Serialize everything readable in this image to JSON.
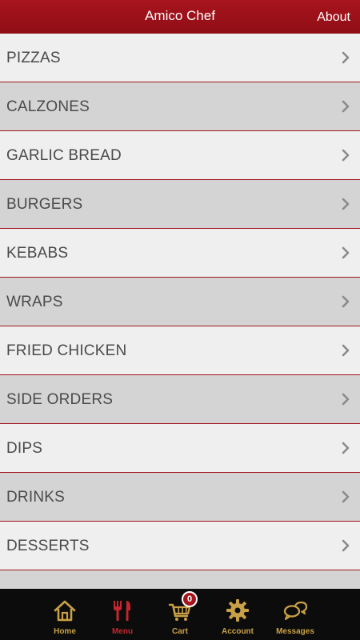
{
  "header": {
    "title": "Amico Chef",
    "about_label": "About"
  },
  "menu": {
    "categories": [
      {
        "label": "PIZZAS"
      },
      {
        "label": "CALZONES"
      },
      {
        "label": "GARLIC BREAD"
      },
      {
        "label": "BURGERS"
      },
      {
        "label": "KEBABS"
      },
      {
        "label": "WRAPS"
      },
      {
        "label": "FRIED CHICKEN"
      },
      {
        "label": "SIDE ORDERS"
      },
      {
        "label": "DIPS"
      },
      {
        "label": "DRINKS"
      },
      {
        "label": "DESSERTS"
      },
      {
        "label": ""
      }
    ],
    "row_icon": "chevron-right-icon"
  },
  "tabbar": {
    "tabs": [
      {
        "label": "Home",
        "icon": "home-icon"
      },
      {
        "label": "Menu",
        "icon": "cutlery-icon",
        "active": true
      },
      {
        "label": "Cart",
        "icon": "cart-icon"
      },
      {
        "label": "Account",
        "icon": "gear-icon"
      },
      {
        "label": "Messages",
        "icon": "chat-bubbles-icon"
      }
    ],
    "cart_count": "0"
  },
  "colors": {
    "header_bg": "#a8141d",
    "row_light": "#efefef",
    "row_dark": "#d4d4d4",
    "divider": "#a0141c",
    "tab_label": "#c9a046",
    "tab_active": "#c3262f",
    "tabbar_bg": "#0c0c0c"
  }
}
